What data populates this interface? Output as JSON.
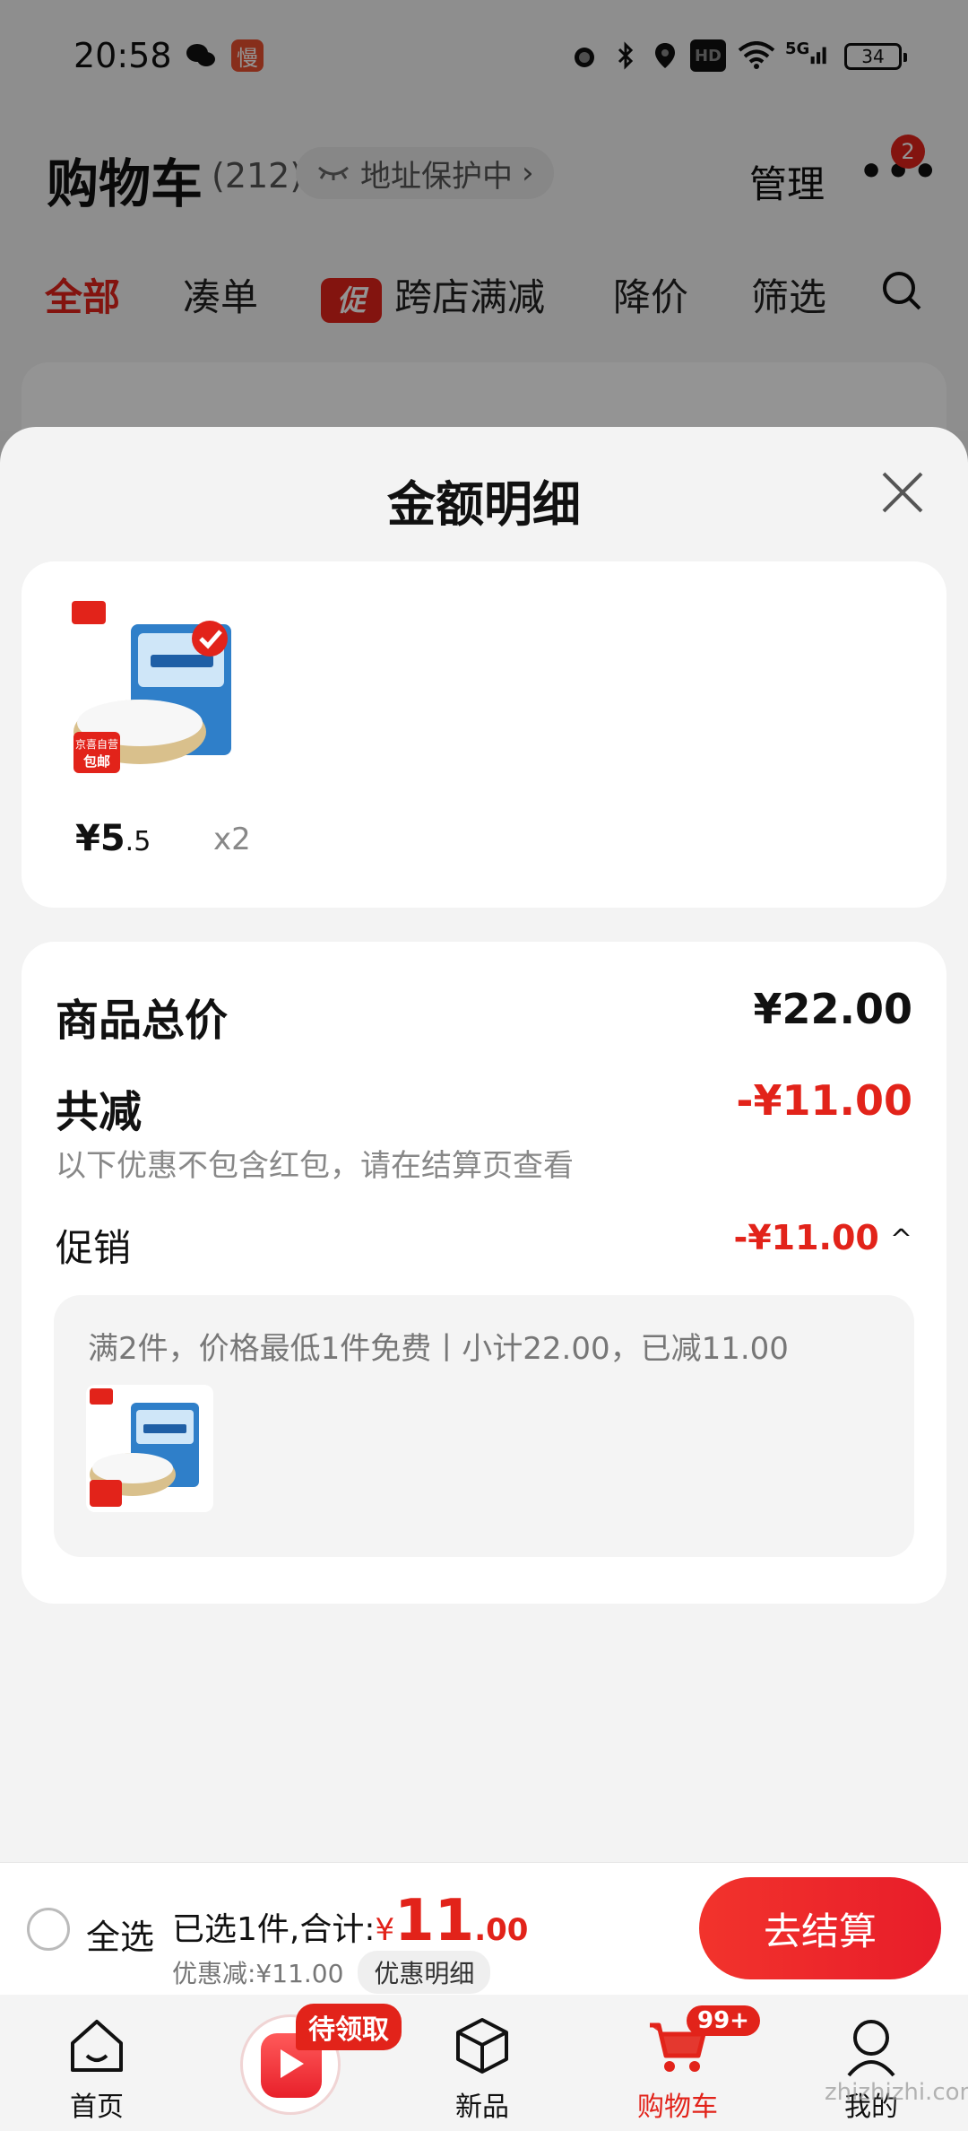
{
  "status_bar": {
    "time": "20:58",
    "app_badge": "慢",
    "battery": "34",
    "network": "5G",
    "hd": "HD"
  },
  "cart_header": {
    "title": "购物车",
    "count": "(212)",
    "address_pill": "地址保护中",
    "manage": "管理",
    "more_badge": "2"
  },
  "filters": {
    "all": "全部",
    "bundle": "凑单",
    "promo_tag": "促",
    "cross_store": "跨店满减",
    "price_drop": "降价",
    "filter": "筛选"
  },
  "sheet": {
    "title": "金额明细",
    "product": {
      "price_int": "¥5",
      "price_dec": ".5",
      "qty": "x2",
      "badge_top": "京喜自营",
      "badge_bottom": "包邮"
    },
    "summary": {
      "total_label": "商品总价",
      "total_value": "¥22.00",
      "reduce_label": "共减",
      "reduce_value": "-¥11.00",
      "note": "以下优惠不包含红包，请在结算页查看",
      "promo_label": "促销",
      "promo_value": "-¥11.00",
      "promo_desc": "满2件，价格最低1件免费丨小计22.00，已减11.00"
    }
  },
  "checkout": {
    "select_all": "全选",
    "selected_prefix": "已选1件,合计:",
    "currency": "¥",
    "total_int": "11",
    "total_dec": ".00",
    "discount_line": "优惠减:¥11.00",
    "detail_button": "优惠明细",
    "pay_button": "去结算"
  },
  "bottom_nav": {
    "home": "首页",
    "live_tag": "待领取",
    "new": "新品",
    "cart": "购物车",
    "cart_badge": "99+",
    "mine": "我的"
  },
  "watermark": "zhizhizhi.com",
  "colors": {
    "accent": "#e2231a",
    "sheet_bg": "#f3f3f3",
    "card_bg": "#ffffff"
  }
}
